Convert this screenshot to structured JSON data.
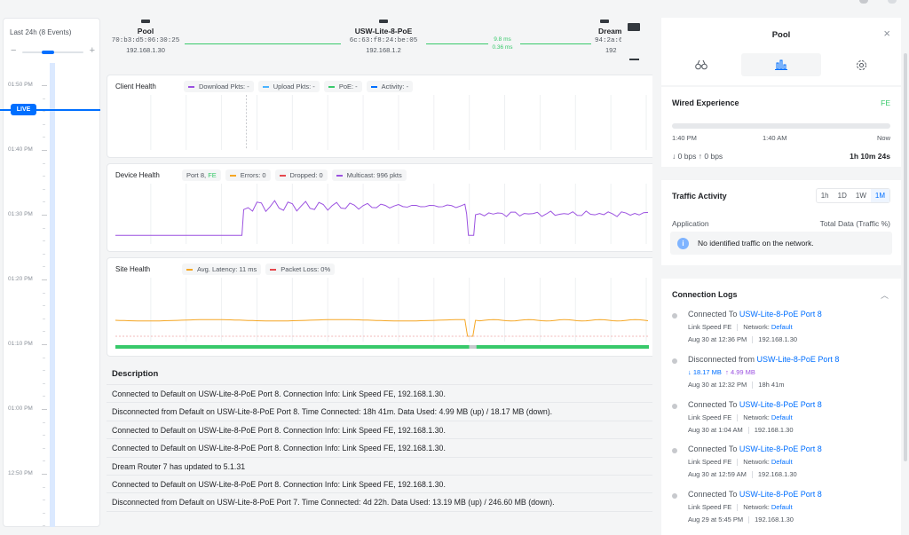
{
  "timeline": {
    "title": "Last 24h (8 Events)",
    "live_label": "LIVE",
    "times": [
      "01:50 PM",
      "01:40 PM",
      "01:30 PM",
      "01:20 PM",
      "01:10 PM",
      "01:00 PM",
      "12:50 PM"
    ]
  },
  "topology": {
    "nodes": [
      {
        "name": "Pool",
        "mac": "70:b3:d5:06:30:25",
        "ip": "192.168.1.30"
      },
      {
        "name": "USW-Lite-8-PoE",
        "mac": "6c:63:f8:24:be:05",
        "ip": "192.168.1.2"
      },
      {
        "name": "Dream",
        "mac": "94:2a:6",
        "ip": "192"
      }
    ],
    "latency": {
      "a": "9.8 ms",
      "b": "0.36 ms"
    }
  },
  "charts": {
    "client": {
      "title": "Client Health",
      "legend": [
        {
          "label": "Download Pkts: -",
          "color": "#9b51e0"
        },
        {
          "label": "Upload Pkts: -",
          "color": "#4ab3ff"
        },
        {
          "label": "PoE: -",
          "color": "#38c96b"
        },
        {
          "label": "Activity: -",
          "color": "#006fff"
        }
      ]
    },
    "device": {
      "title": "Device Health",
      "port": "Port 8,",
      "port_speed": "FE",
      "legend": [
        {
          "label": "Errors: 0",
          "color": "#f5a623"
        },
        {
          "label": "Dropped: 0",
          "color": "#e5484d"
        },
        {
          "label": "Multicast: 996 pkts",
          "color": "#9b51e0"
        }
      ]
    },
    "site": {
      "title": "Site Health",
      "legend": [
        {
          "label": "Avg. Latency: 11 ms",
          "color": "#f5a623"
        },
        {
          "label": "Packet Loss: 0%",
          "color": "#e5484d"
        }
      ]
    }
  },
  "description": {
    "header": "Description",
    "rows": [
      "Connected to Default on USW-Lite-8-PoE Port 8. Connection Info: Link Speed FE, 192.168.1.30.",
      "Disconnected from Default on USW-Lite-8-PoE Port 8. Time Connected: 18h 41m. Data Used: 4.99 MB (up) / 18.17 MB (down).",
      "Connected to Default on USW-Lite-8-PoE Port 8. Connection Info: Link Speed FE, 192.168.1.30.",
      "Connected to Default on USW-Lite-8-PoE Port 8. Connection Info: Link Speed FE, 192.168.1.30.",
      "Dream Router 7 has updated to 5.1.31",
      "Connected to Default on USW-Lite-8-PoE Port 8. Connection Info: Link Speed FE, 192.168.1.30.",
      "Disconnected from Default on USW-Lite-8-PoE Port 7. Time Connected: 4d 22h. Data Used: 13.19 MB (up) / 246.60 MB (down)."
    ]
  },
  "panel": {
    "title": "Pool",
    "tabs": [
      "binoculars-icon",
      "chart-icon",
      "gear-icon"
    ],
    "wired": {
      "title": "Wired Experience",
      "badge": "FE",
      "t_start": "1:40 PM",
      "t_mid": "1:40 AM",
      "t_end": "Now",
      "traffic": "↓ 0 bps  ↑ 0 bps",
      "uptime": "1h 10m 24s"
    },
    "traffic": {
      "title": "Traffic Activity",
      "ranges": [
        "1h",
        "1D",
        "1W",
        "1M"
      ],
      "col_app": "Application",
      "col_total": "Total Data (Traffic %)",
      "empty": "No identified traffic on the network."
    },
    "logs": {
      "title": "Connection Logs",
      "entries": [
        {
          "prefix": "Connected To ",
          "target": "USW-Lite-8-PoE Port 8",
          "d1a": "Link Speed FE",
          "d1b": "Network: ",
          "d1c": "Default",
          "time": "Aug 30 at 12:36 PM",
          "extra": "192.168.1.30"
        },
        {
          "prefix": "Disconnected from ",
          "target": "USW-Lite-8-PoE Port 8",
          "down": "↓ 18.17 MB",
          "up": "↑ 4.99 MB",
          "time": "Aug 30 at 12:32 PM",
          "extra": "18h 41m"
        },
        {
          "prefix": "Connected To ",
          "target": "USW-Lite-8-PoE Port 8",
          "d1a": "Link Speed FE",
          "d1b": "Network: ",
          "d1c": "Default",
          "time": "Aug 30 at 1:04 AM",
          "extra": "192.168.1.30"
        },
        {
          "prefix": "Connected To ",
          "target": "USW-Lite-8-PoE Port 8",
          "d1a": "Link Speed FE",
          "d1b": "Network: ",
          "d1c": "Default",
          "time": "Aug 30 at 12:59 AM",
          "extra": "192.168.1.30"
        },
        {
          "prefix": "Connected To ",
          "target": "USW-Lite-8-PoE Port 8",
          "d1a": "Link Speed FE",
          "d1b": "Network: ",
          "d1c": "Default",
          "time": "Aug 29 at 5:45 PM",
          "extra": "192.168.1.30"
        }
      ]
    }
  }
}
